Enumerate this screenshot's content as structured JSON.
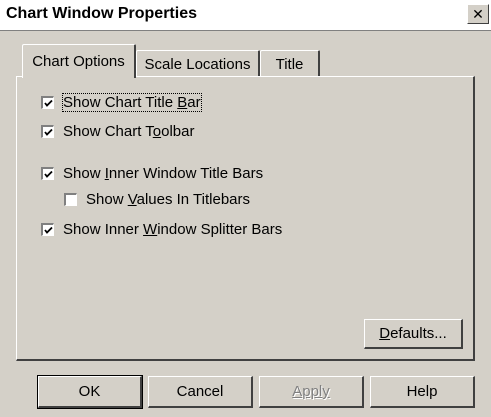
{
  "window": {
    "title": "Chart Window Properties",
    "close_glyph": "✕"
  },
  "tabs": [
    {
      "label": "Chart Options",
      "active": true
    },
    {
      "label": "Scale Locations",
      "active": false
    },
    {
      "label": "Title",
      "active": false
    }
  ],
  "options": [
    {
      "pre": "Show Chart Title ",
      "key": "B",
      "post": "ar",
      "checked": true
    },
    {
      "pre": "Show Chart T",
      "key": "o",
      "post": "olbar",
      "checked": true
    },
    {
      "pre": "Show ",
      "key": "I",
      "post": "nner Window Title Bars",
      "checked": true
    },
    {
      "pre": "Show ",
      "key": "V",
      "post": "alues In Titlebars",
      "checked": false
    },
    {
      "pre": "Show Inner ",
      "key": "W",
      "post": "indow Splitter Bars",
      "checked": true
    }
  ],
  "defaults_button": {
    "key": "D",
    "post": "efaults..."
  },
  "buttons": {
    "ok": "OK",
    "cancel": "Cancel",
    "apply": "Apply",
    "help": "Help"
  },
  "colors": {
    "face": "#d4d0c8",
    "shadow": "#404040",
    "disabled_text": "#808080"
  }
}
